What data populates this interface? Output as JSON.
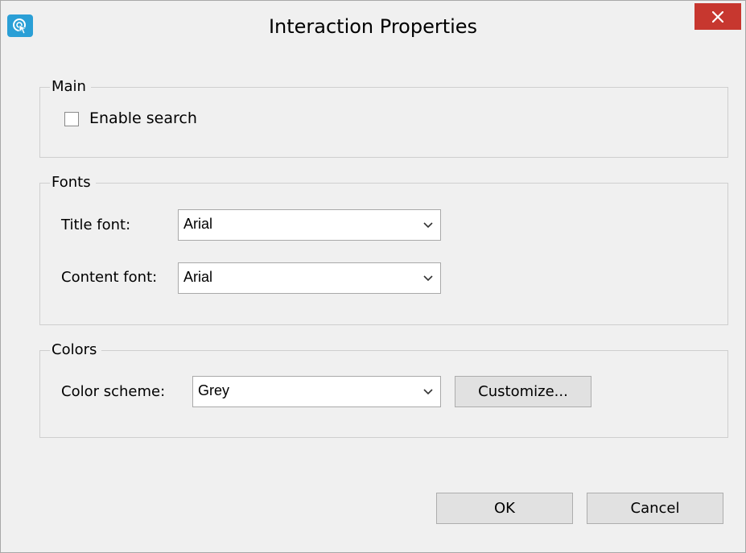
{
  "window": {
    "title": "Interaction Properties",
    "icon": "touch-icon",
    "close_icon": "close-icon"
  },
  "main": {
    "legend": "Main",
    "enable_search": {
      "label": "Enable search",
      "checked": false
    }
  },
  "fonts": {
    "legend": "Fonts",
    "title_font": {
      "label": "Title font:",
      "value": "Arial"
    },
    "content_font": {
      "label": "Content font:",
      "value": "Arial"
    }
  },
  "colors": {
    "legend": "Colors",
    "color_scheme": {
      "label": "Color scheme:",
      "value": "Grey"
    },
    "customize_label": "Customize..."
  },
  "footer": {
    "ok_label": "OK",
    "cancel_label": "Cancel"
  },
  "palette": {
    "close_bg": "#c7372f",
    "app_icon_bg": "#2a9fd6",
    "window_bg": "#f0f0f0"
  }
}
